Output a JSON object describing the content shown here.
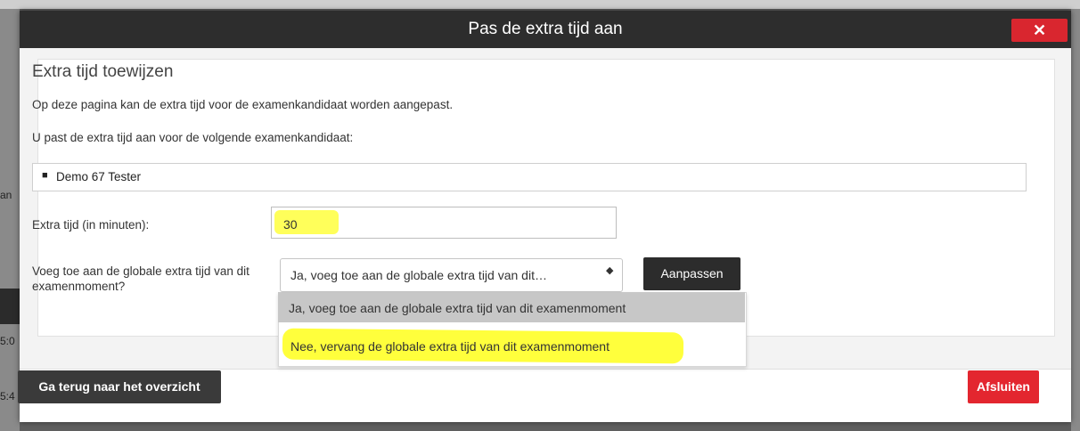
{
  "modal": {
    "title": "Pas de extra tijd aan",
    "close_symbol": "✕"
  },
  "panel": {
    "heading": "Extra tijd toewijzen",
    "intro": "Op deze pagina kan de extra tijd voor de examenkandidaat worden aangepast.",
    "candidate_intro": "U past de extra tijd aan voor de volgende examenkandidaat:",
    "candidates": [
      "Demo 67 Tester"
    ]
  },
  "form": {
    "extra_time_label": "Extra tijd (in minuten):",
    "extra_time_value": "30",
    "add_global_label": "Voeg toe aan de globale extra tijd van dit examenmoment?",
    "select_value": "Ja, voeg toe aan de globale extra tijd van dit…",
    "select_arrows": "◆",
    "options": [
      "Ja, voeg toe aan de globale extra tijd van dit examenmoment",
      "Nee, vervang de globale extra tijd van dit examenmoment"
    ],
    "adjust_label": "Aanpassen"
  },
  "footer": {
    "back_label": "Ga terug naar het overzicht",
    "close_label": "Afsluiten"
  },
  "background": {
    "fragments": [
      "an",
      "5:0",
      "5:4"
    ]
  },
  "colors": {
    "header": "#2d2d2d",
    "danger": "#d9262f",
    "highlight": "#ffff3c"
  }
}
